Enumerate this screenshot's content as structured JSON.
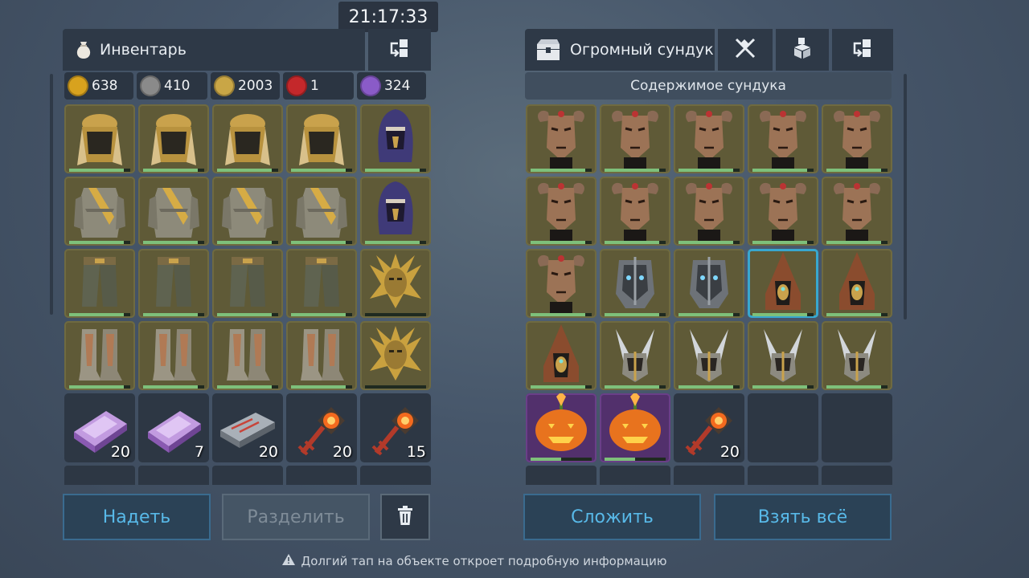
{
  "clock": "21:17:33",
  "inventory": {
    "title": "Инвентарь",
    "currencies": [
      {
        "icon": "gold-coin-icon",
        "value": "638",
        "color": "#d8a21e"
      },
      {
        "icon": "iron-token-icon",
        "value": "410",
        "color": "#8a8a8a"
      },
      {
        "icon": "crown-token-icon",
        "value": "2003",
        "color": "#c9a646"
      },
      {
        "icon": "red-emblem-icon",
        "value": "1",
        "color": "#c4282b"
      },
      {
        "icon": "purple-crystal-icon",
        "value": "324",
        "color": "#8a5bc8"
      }
    ],
    "slots": [
      {
        "item": "desert-helmet",
        "style": "gold",
        "durability": 0.9
      },
      {
        "item": "desert-helmet",
        "style": "gold",
        "durability": 0.9
      },
      {
        "item": "desert-helmet",
        "style": "gold",
        "durability": 0.9
      },
      {
        "item": "desert-helmet",
        "style": "gold",
        "durability": 0.9
      },
      {
        "item": "purple-hood",
        "style": "gold",
        "durability": 0.9
      },
      {
        "item": "desert-armor",
        "style": "gold",
        "durability": 0.9
      },
      {
        "item": "desert-armor",
        "style": "gold",
        "durability": 0.9
      },
      {
        "item": "desert-armor",
        "style": "gold",
        "durability": 0.9
      },
      {
        "item": "desert-armor",
        "style": "gold",
        "durability": 0.9
      },
      {
        "item": "purple-hood",
        "style": "gold",
        "durability": 0.9
      },
      {
        "item": "desert-pants",
        "style": "gold",
        "durability": 0.9
      },
      {
        "item": "desert-pants",
        "style": "gold",
        "durability": 0.9
      },
      {
        "item": "desert-pants",
        "style": "gold",
        "durability": 0.9
      },
      {
        "item": "desert-pants",
        "style": "gold",
        "durability": 0.9
      },
      {
        "item": "golden-mask",
        "style": "gold",
        "durability": 0.0
      },
      {
        "item": "desert-boots",
        "style": "gold",
        "durability": 0.9
      },
      {
        "item": "desert-boots",
        "style": "gold",
        "durability": 0.9
      },
      {
        "item": "desert-boots",
        "style": "gold",
        "durability": 0.9
      },
      {
        "item": "desert-boots",
        "style": "gold",
        "durability": 0.9
      },
      {
        "item": "golden-mask",
        "style": "gold",
        "durability": 0.0
      },
      {
        "item": "purple-ingot",
        "style": "plain",
        "qty": "20"
      },
      {
        "item": "purple-ingot",
        "style": "plain",
        "qty": "7"
      },
      {
        "item": "steel-bar",
        "style": "plain",
        "qty": "20"
      },
      {
        "item": "flame-key",
        "style": "plain",
        "qty": "20"
      },
      {
        "item": "flame-key",
        "style": "plain",
        "qty": "15"
      }
    ],
    "buttons": {
      "equip": "Надеть",
      "split": "Разделить"
    }
  },
  "chest": {
    "title": "Огромный сундук",
    "section_label": "Содержимое сундука",
    "slots": [
      {
        "item": "demon-mask",
        "style": "gold",
        "durability": 0.9
      },
      {
        "item": "demon-mask",
        "style": "gold",
        "durability": 0.9
      },
      {
        "item": "demon-mask",
        "style": "gold",
        "durability": 0.9
      },
      {
        "item": "demon-mask",
        "style": "gold",
        "durability": 0.9
      },
      {
        "item": "demon-mask",
        "style": "gold",
        "durability": 0.9
      },
      {
        "item": "demon-mask",
        "style": "gold",
        "durability": 0.9
      },
      {
        "item": "demon-mask",
        "style": "gold",
        "durability": 0.9
      },
      {
        "item": "demon-mask",
        "style": "gold",
        "durability": 0.9
      },
      {
        "item": "demon-mask",
        "style": "gold",
        "durability": 0.9
      },
      {
        "item": "demon-mask",
        "style": "gold",
        "durability": 0.9
      },
      {
        "item": "demon-mask",
        "style": "gold",
        "durability": 0.9
      },
      {
        "item": "knight-helm",
        "style": "gold",
        "durability": 0.9
      },
      {
        "item": "knight-helm",
        "style": "gold",
        "durability": 0.9
      },
      {
        "item": "brown-hood",
        "style": "selected",
        "durability": 0.9
      },
      {
        "item": "brown-hood",
        "style": "gold",
        "durability": 0.9
      },
      {
        "item": "brown-hood",
        "style": "gold",
        "durability": 0.9
      },
      {
        "item": "winged-helm",
        "style": "gold",
        "durability": 0.9
      },
      {
        "item": "winged-helm",
        "style": "gold",
        "durability": 0.9
      },
      {
        "item": "winged-helm",
        "style": "gold",
        "durability": 0.9
      },
      {
        "item": "winged-helm",
        "style": "gold",
        "durability": 0.9
      },
      {
        "item": "jack-o-lantern",
        "style": "purple",
        "durability": 0.5
      },
      {
        "item": "jack-o-lantern",
        "style": "purple",
        "durability": 0.5
      },
      {
        "item": "flame-key",
        "style": "plain",
        "qty": "20"
      },
      {
        "item": "empty",
        "style": "plain"
      },
      {
        "item": "empty",
        "style": "plain"
      }
    ],
    "buttons": {
      "stack": "Сложить",
      "take_all": "Взять всё"
    }
  },
  "hint": "Долгий тап на объекте откроет подробную информацию"
}
